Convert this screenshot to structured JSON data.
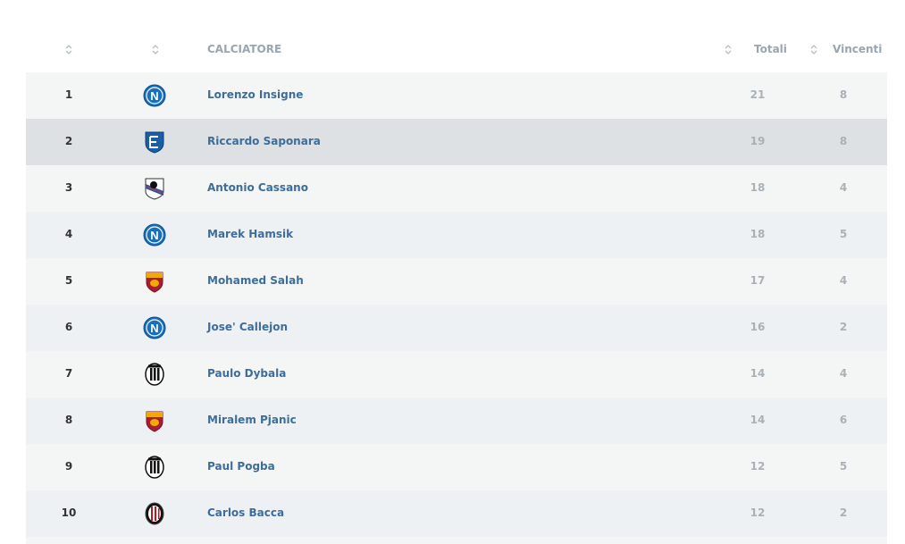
{
  "header": {
    "player_label": "CALCIATORE",
    "totali_label": "Totali",
    "vincenti_label": "Vincenti"
  },
  "clubs": {
    "napoli": {
      "color": "#1a6fc1",
      "letter": "N"
    },
    "empoli": {
      "color": "#1b5ea8"
    },
    "sampdoria": {
      "color": "#1f59a8"
    },
    "roma": {
      "color": "#a91d34",
      "accent": "#f2a900"
    },
    "juventus": {
      "color": "#111111"
    },
    "milan": {
      "color": "#c9101d"
    }
  },
  "rows": [
    {
      "rank": "1",
      "club": "napoli",
      "player": "Lorenzo Insigne",
      "totali": "21",
      "vincenti": "8"
    },
    {
      "rank": "2",
      "club": "empoli",
      "player": "Riccardo Saponara",
      "totali": "19",
      "vincenti": "8"
    },
    {
      "rank": "3",
      "club": "sampdoria",
      "player": "Antonio Cassano",
      "totali": "18",
      "vincenti": "4"
    },
    {
      "rank": "4",
      "club": "napoli",
      "player": "Marek Hamsik",
      "totali": "18",
      "vincenti": "5"
    },
    {
      "rank": "5",
      "club": "roma",
      "player": "Mohamed Salah",
      "totali": "17",
      "vincenti": "4"
    },
    {
      "rank": "6",
      "club": "napoli",
      "player": "Jose' Callejon",
      "totali": "16",
      "vincenti": "2"
    },
    {
      "rank": "7",
      "club": "juventus",
      "player": "Paulo Dybala",
      "totali": "14",
      "vincenti": "4"
    },
    {
      "rank": "8",
      "club": "roma",
      "player": "Miralem Pjanic",
      "totali": "14",
      "vincenti": "6"
    },
    {
      "rank": "9",
      "club": "juventus",
      "player": "Paul Pogba",
      "totali": "12",
      "vincenti": "5"
    },
    {
      "rank": "10",
      "club": "milan",
      "player": "Carlos Bacca",
      "totali": "12",
      "vincenti": "2"
    }
  ]
}
